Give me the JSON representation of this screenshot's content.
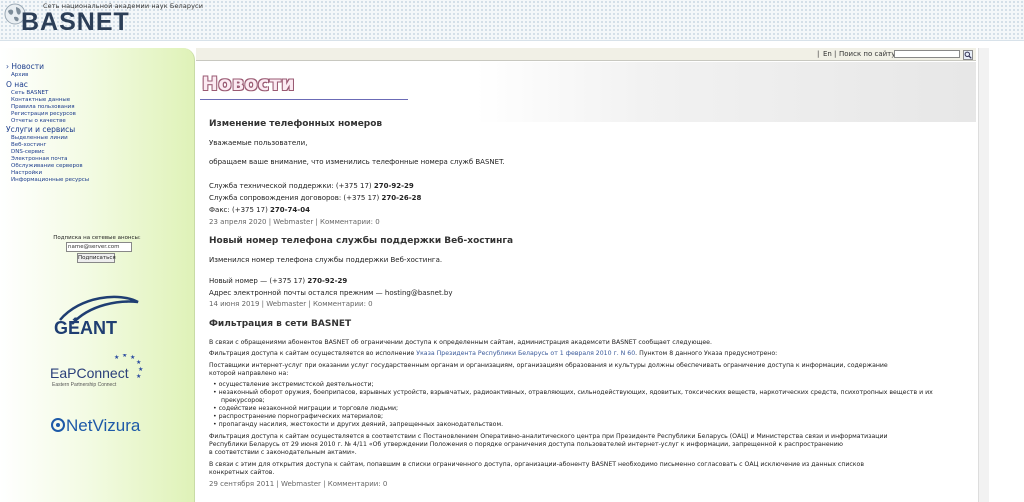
{
  "header": {
    "logo_subtitle": "Сеть национальной академии наук Беларуси",
    "logo_text": "BASNET"
  },
  "topbar": {
    "lang": "En",
    "search_label": "Поиск по сайту:",
    "search_value": ""
  },
  "sidebar": {
    "items": [
      {
        "label": "Новости",
        "level": "top",
        "active": true
      },
      {
        "label": "Архив",
        "level": "sub"
      },
      {
        "label": "О нас",
        "level": "top"
      },
      {
        "label": "Сеть BASNET",
        "level": "sub"
      },
      {
        "label": "Контактные данные",
        "level": "sub"
      },
      {
        "label": "Правила пользования",
        "level": "sub"
      },
      {
        "label": "Регистрация ресурсов",
        "level": "sub"
      },
      {
        "label": "Отчеты о качестве",
        "level": "sub"
      },
      {
        "label": "Услуги и сервисы",
        "level": "top"
      },
      {
        "label": "Выделенные линии",
        "level": "sub"
      },
      {
        "label": "Веб-хостинг",
        "level": "sub"
      },
      {
        "label": "DNS-сервис",
        "level": "sub"
      },
      {
        "label": "Электронная почта",
        "level": "sub"
      },
      {
        "label": "Обслуживание серверов",
        "level": "sub"
      },
      {
        "label": "Настройки",
        "level": "sub"
      },
      {
        "label": "Информационные ресурсы",
        "level": "sub"
      }
    ],
    "subscribe": {
      "label": "Подписка на сетевые анонсы:",
      "email_value": "name@server.com",
      "button": "Подписаться"
    },
    "partners": {
      "geant": "GÉANT",
      "eap_main": "EaPConnect",
      "eap_sub": "Eastern Partnership Connect",
      "netvizura": "NetVizura"
    }
  },
  "main": {
    "title": "Новости",
    "lines": [
      {
        "id": "n1-title",
        "text": "Изменение телефонных номеров"
      },
      {
        "id": "n1-p1",
        "text": "Уважаемые пользователи,"
      },
      {
        "id": "n1-p2",
        "text": "обращаем ваше внимание, что изменились телефонные номера служб BASNET."
      },
      {
        "id": "n1-c1a",
        "text": "Служба технической поддержки: (+375 17) "
      },
      {
        "id": "n1-c1b",
        "text": "270-92-29"
      },
      {
        "id": "n1-c2a",
        "text": "Служба сопровождения договоров: (+375 17) "
      },
      {
        "id": "n1-c2b",
        "text": "270-26-28"
      },
      {
        "id": "n1-c3a",
        "text": "Факс: (+375 17) "
      },
      {
        "id": "n1-c3b",
        "text": "270-74-04"
      },
      {
        "id": "n1-meta",
        "text": "23 апреля 2020 | Webmaster | Комментарии: 0"
      },
      {
        "id": "n2-title",
        "text": "Новый номер телефона службы поддержки Веб-хостинга"
      },
      {
        "id": "n2-p1",
        "text": "Изменился номер телефона службы поддержки Веб-хостинга."
      },
      {
        "id": "n2-p2a",
        "text": "Новый номер — (+375 17) "
      },
      {
        "id": "n2-p2b",
        "text": "270-92-29"
      },
      {
        "id": "n2-p3",
        "text": "Адрес электронной почты остался прежним — hosting@basnet.by"
      },
      {
        "id": "n2-meta",
        "text": "14 июня 2019 | Webmaster | Комментарии: 0"
      },
      {
        "id": "n3-title",
        "text": "Фильтрация в сети BASNET"
      },
      {
        "id": "n3-p1",
        "text": "В связи с обращениями абонентов BASNET об ограничении доступа к определенным сайтам, администрация академсети BASNET сообщает следующее."
      },
      {
        "id": "n3-p2a",
        "text": "Фильтрация доступа к сайтам осуществляется во исполнение "
      },
      {
        "id": "n3-p2link",
        "text": "Указа Президента Республики Беларусь от 1 февраля 2010 г. N 60"
      },
      {
        "id": "n3-p2b",
        "text": ". Пунктом 8 данного Указа предусмотрено:"
      },
      {
        "id": "n3-p3a",
        "text": "Поставщики интернет-услуг при оказании услуг государственным органам и организациям, организациям образования и культуры должны обеспечивать ограничение доступа к информации, содержание"
      },
      {
        "id": "n3-p3b",
        "text": "которой направлено на:"
      },
      {
        "id": "n3-b1",
        "text": "осуществление экстремистской деятельности;"
      },
      {
        "id": "n3-b2a",
        "text": "незаконный оборот оружия, боеприпасов, взрывных устройств, взрывчатых, радиоактивных, отравляющих, сильнодействующих, ядовитых, токсических веществ, наркотических средств, психотропных веществ и их"
      },
      {
        "id": "n3-b2b",
        "text": "прекурсоров;"
      },
      {
        "id": "n3-b3",
        "text": "содействие незаконной миграции и торговле людьми;"
      },
      {
        "id": "n3-b4",
        "text": "распространение порнографических материалов;"
      },
      {
        "id": "n3-b5",
        "text": "пропаганду насилия, жестокости и других деяний, запрещенных законодательством."
      },
      {
        "id": "n3-p4a",
        "text": "Фильтрация доступа к сайтам осуществляется в соответствии с Постановлением Оперативно-аналитического центра при Президенте Республики Беларусь (ОАЦ) и Министерства связи и информатизации"
      },
      {
        "id": "n3-p4b",
        "text": "Республики Беларусь от 29 июня 2010 г. № 4/11 «Об утверждении Положения о порядке ограничения доступа пользователей интернет-услуг к информации, запрещенной к распространению"
      },
      {
        "id": "n3-p4c",
        "text": "в соответствии с законодательным актами»."
      },
      {
        "id": "n3-p5a",
        "text": "В связи с этим для открытия доступа к сайтам, попавшим в списки ограниченного доступа, организации-абоненту BASNET необходимо письменно согласовать с ОАЦ исключение из данных списков"
      },
      {
        "id": "n3-p5b",
        "text": "конкретных сайтов."
      },
      {
        "id": "n3-meta",
        "text": "29 сентября 2011 | Webmaster | Комментарии: 0"
      }
    ]
  },
  "colors": {
    "nav_link": "#1b3c8c",
    "sidebar_green": "#dff2b8",
    "title_outline": "#9a5a73"
  }
}
